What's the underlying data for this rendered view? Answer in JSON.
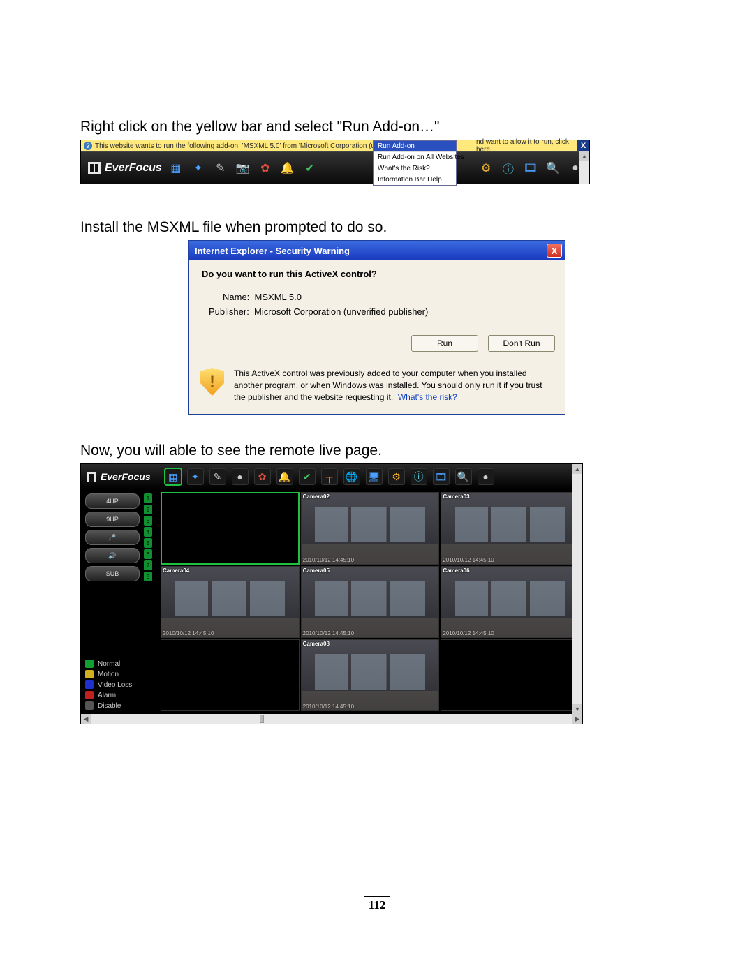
{
  "instructions": {
    "step1": "Right click on the yellow bar and select \"Run Add-on…\"",
    "step2": "Install the MSXML file when prompted to do so.",
    "step3": "Now, you will able to see the remote live page."
  },
  "infobar": {
    "text_left": "This website wants to run the following add-on: 'MSXML 5.0' from 'Microsoft Corporation (unverified publisher)'. If y",
    "text_right": "nd want to allow it to run, click here…",
    "close": "X"
  },
  "context_menu": {
    "items": [
      "Run Add-on",
      "Run Add-on on All Websites",
      "What's the Risk?",
      "Information Bar Help"
    ]
  },
  "brand": "EverFocus",
  "dialog": {
    "title": "Internet Explorer - Security Warning",
    "question": "Do you want to run this ActiveX control?",
    "name_label": "Name:",
    "name_value": "MSXML 5.0",
    "publisher_label": "Publisher:",
    "publisher_value": "Microsoft Corporation (unverified publisher)",
    "btn_run": "Run",
    "btn_dont_run": "Don't Run",
    "warning_text": "This ActiveX control was previously added to your computer when you installed another program, or when Windows was installed. You should only run it if you trust the publisher and the website requesting it.",
    "risk_link": "What's the risk?"
  },
  "live": {
    "controls": {
      "four_up": "4UP",
      "nine_up": "9UP",
      "sub": "SUB"
    },
    "channels": [
      "1",
      "2",
      "3",
      "4",
      "5",
      "6",
      "7",
      "8"
    ],
    "legend": {
      "normal": "Normal",
      "motion": "Motion",
      "video_loss": "Video Loss",
      "alarm": "Alarm",
      "disable": "Disable"
    },
    "cameras": [
      {
        "label": "",
        "ts": ""
      },
      {
        "label": "Camera02",
        "ts": "2010/10/12 14:45:10"
      },
      {
        "label": "Camera03",
        "ts": "2010/10/12 14:45:10"
      },
      {
        "label": "Camera04",
        "ts": "2010/10/12 14:45:10"
      },
      {
        "label": "Camera05",
        "ts": "2010/10/12 14:45:10"
      },
      {
        "label": "Camera06",
        "ts": "2010/10/12 14:45:10"
      },
      {
        "label": "",
        "ts": ""
      },
      {
        "label": "Camera08",
        "ts": "2010/10/12 14:45:10"
      },
      {
        "label": "",
        "ts": ""
      }
    ]
  },
  "toolbar_icons": [
    "grid",
    "sparkle",
    "wand",
    "camera",
    "reel",
    "bell",
    "clock-ok",
    "network",
    "globe",
    "monitor",
    "gear",
    "info",
    "film",
    "search",
    "bulb"
  ],
  "page_number": "112"
}
